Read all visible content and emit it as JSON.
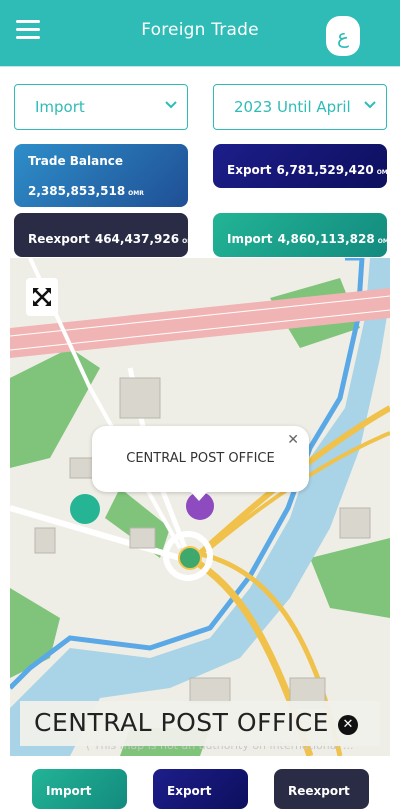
{
  "header": {
    "title": "Foreign Trade",
    "language_label": "ع"
  },
  "filters": {
    "trade_type": "Import",
    "period": "2023 Until April"
  },
  "cards": {
    "trade_balance": {
      "label": "Trade Balance",
      "value": "2,385,853,518",
      "unit": "OMR"
    },
    "export": {
      "label": "Export",
      "value": "6,781,529,420",
      "unit": "OMR"
    },
    "reexport": {
      "label": "Reexport",
      "value": "464,437,926",
      "unit": "OMR"
    },
    "import": {
      "label": "Import",
      "value": "4,860,113,828",
      "unit": "OMR"
    }
  },
  "map": {
    "popup_text": "CENTRAL POST OFFICE",
    "selected_place": "CENTRAL POST OFFICE",
    "attribution": "( This map is not an authority on international ..."
  },
  "tabs": {
    "import": "Import",
    "export": "Export",
    "reexport": "Reexport"
  },
  "colors": {
    "accent": "#2fbcb7",
    "export": "#12136b",
    "import": "#1ea68e",
    "reexport": "#2a2c45",
    "marker": "#8d4bbf"
  }
}
